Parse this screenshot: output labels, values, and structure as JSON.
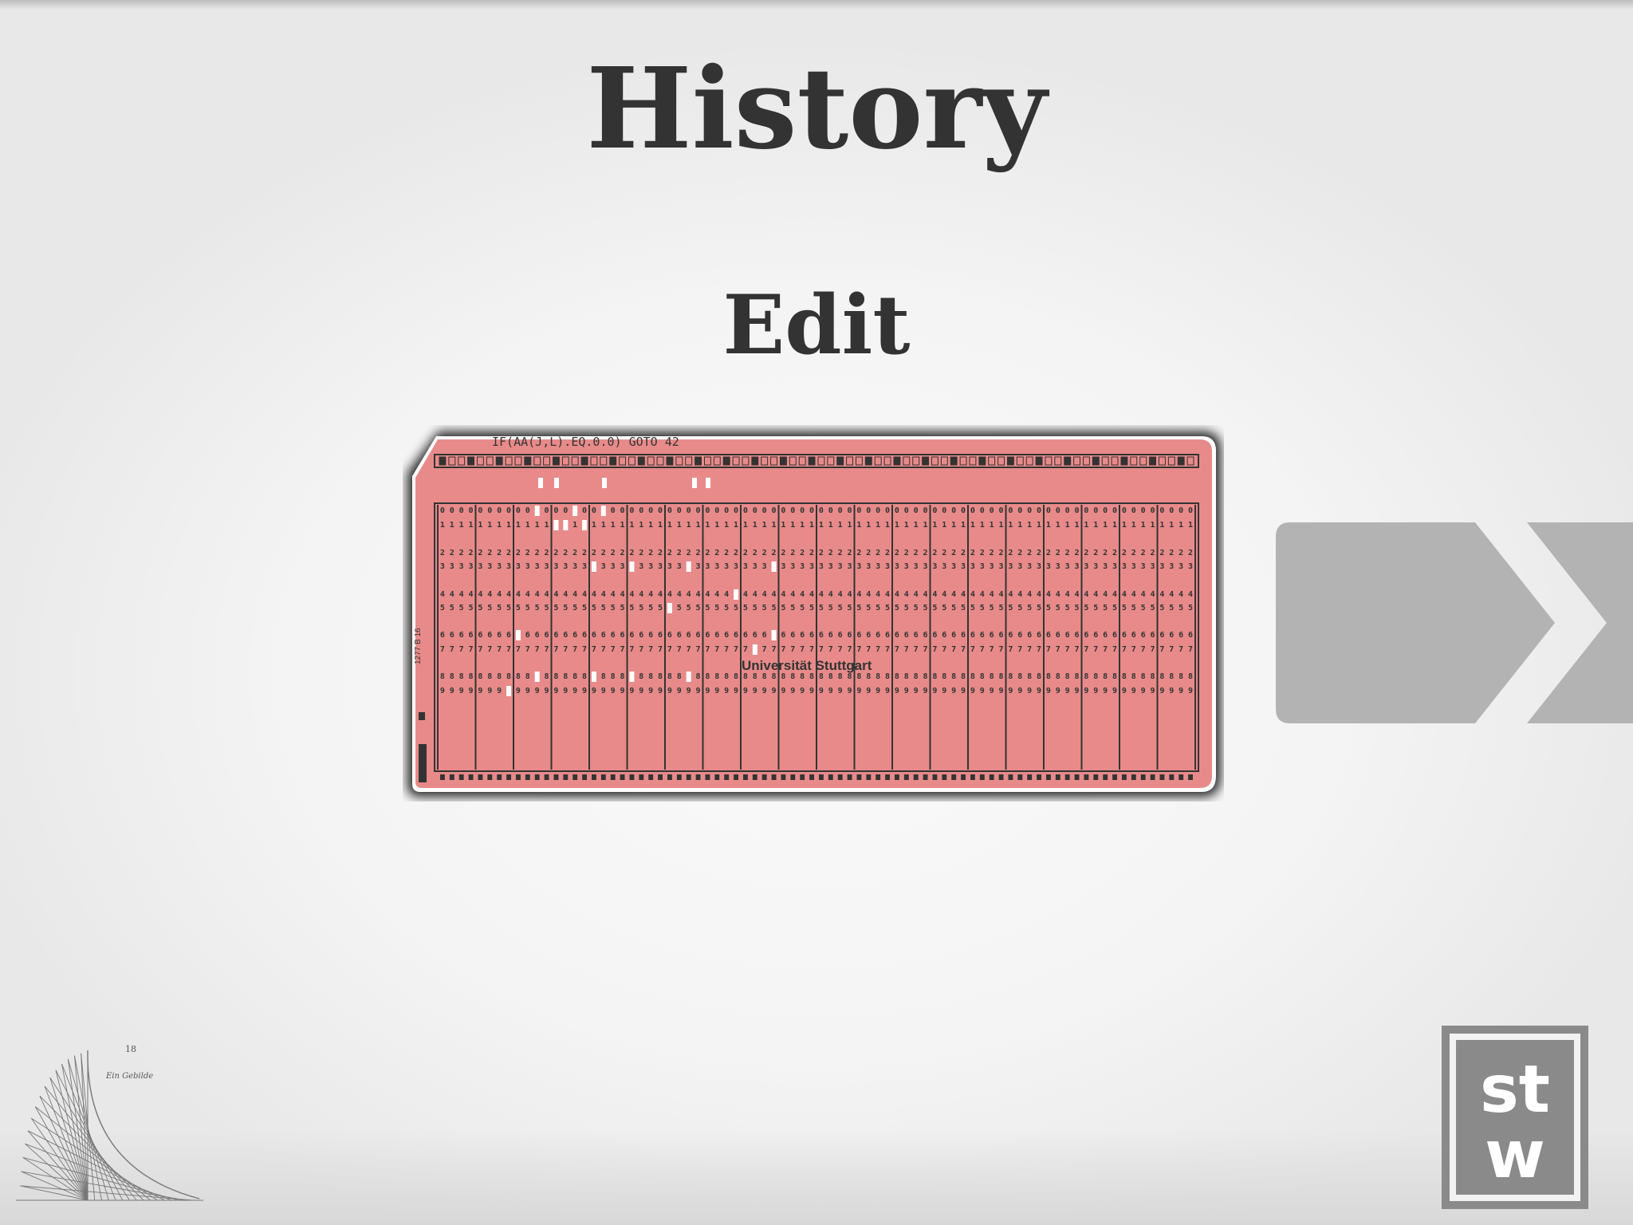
{
  "slide": {
    "title": "History",
    "subtitle": "Edit"
  },
  "punch_card": {
    "printed_code": "IF(AA(J,L).EQ.0.0)  GOTO 42",
    "printed_label": "Universität Stuttgart",
    "side_number": "1277  B 16",
    "card_color": "#e88a8a",
    "digit_rows": [
      "0",
      "1",
      "2",
      "3",
      "4",
      "5",
      "6",
      "7",
      "8",
      "9"
    ]
  },
  "next_arrow": {
    "icon": "next-chevron-icon",
    "color": "#b3b3b3"
  },
  "logo": {
    "text_top": "st",
    "text_bottom": "w",
    "color": "#8a8a8a"
  },
  "sketch": {
    "annotation_number": "18",
    "annotation_text": "Ein Gebilde"
  }
}
